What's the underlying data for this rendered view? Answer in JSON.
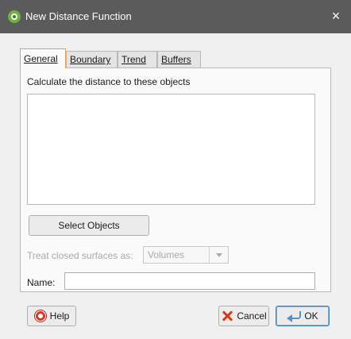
{
  "window": {
    "title": "New Distance Function",
    "close_glyph": "×"
  },
  "tabs": [
    {
      "label": "General",
      "active": true
    },
    {
      "label": "Boundary",
      "active": false
    },
    {
      "label": "Trend",
      "active": false
    },
    {
      "label": "Buffers",
      "active": false
    }
  ],
  "general": {
    "objects_label": "Calculate the distance to these objects",
    "select_objects_label": "Select Objects",
    "treat_closed_label": "Treat closed surfaces as:",
    "treat_closed_value": "Volumes",
    "name_label": "Name:",
    "name_value": ""
  },
  "footer": {
    "help_label": "Help",
    "cancel_label": "Cancel",
    "ok_label": "OK"
  },
  "icons": {
    "app": "leapfrog-app-icon",
    "help": "lifebuoy-icon",
    "cancel": "cancel-x-icon",
    "ok": "ok-arrow-icon"
  },
  "colors": {
    "titlebar": "#5b5b5b",
    "active_tab_border": "#e8a050",
    "ok_border": "#3c7fb1"
  }
}
